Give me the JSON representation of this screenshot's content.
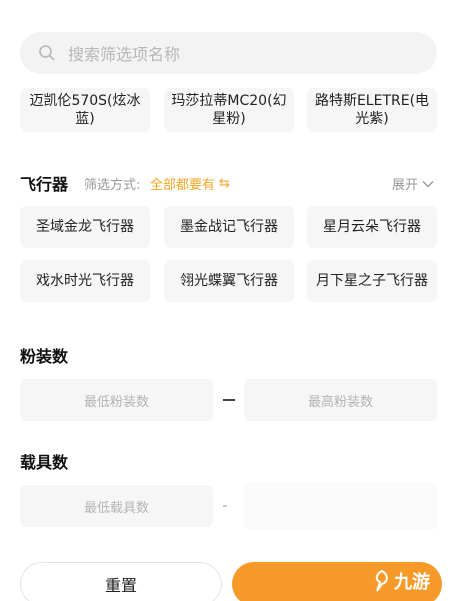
{
  "search": {
    "placeholder": "搜索筛选项名称"
  },
  "top_chips": [
    {
      "label": "迈凯伦570S(炫冰蓝)"
    },
    {
      "label": "玛莎拉蒂MC20(幻星粉)"
    },
    {
      "label": "路特斯ELETRE(电光紫)"
    }
  ],
  "aircraft": {
    "title": "飞行器",
    "filter_label": "筛选方式:",
    "filter_value": "全部都要有",
    "expand_label": "展开",
    "items": [
      {
        "label": "圣域金龙飞行器"
      },
      {
        "label": "墨金战记飞行器"
      },
      {
        "label": "星月云朵飞行器"
      },
      {
        "label": "戏水时光飞行器"
      },
      {
        "label": "翎光蝶翼飞行器"
      },
      {
        "label": "月下星之子飞行器"
      }
    ]
  },
  "pink_count": {
    "title": "粉装数",
    "min_placeholder": "最低粉装数",
    "max_placeholder": "最高粉装数"
  },
  "vehicle_count": {
    "title": "载具数",
    "min_placeholder": "最低载具数"
  },
  "footer": {
    "reset_label": "重置"
  },
  "watermark": {
    "text": "九游"
  },
  "colors": {
    "accent": "#f5a623",
    "confirm": "#f79a2a",
    "chip_bg": "#f6f6f6"
  }
}
